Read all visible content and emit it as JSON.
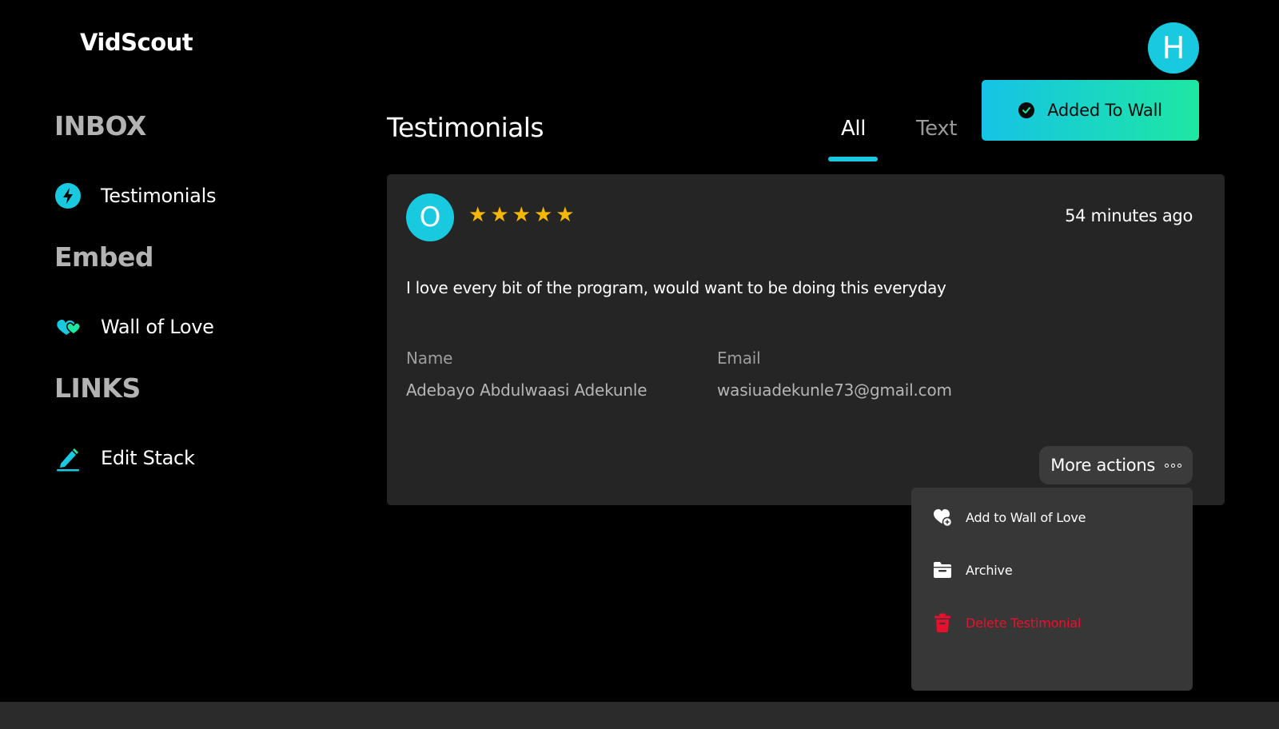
{
  "app": {
    "logo": "VidScout",
    "user_initial": "H"
  },
  "sidebar": {
    "sections": [
      {
        "heading": "INBOX",
        "items": [
          {
            "label": "Testimonials",
            "icon": "bolt-icon"
          }
        ]
      },
      {
        "heading": "Embed",
        "items": [
          {
            "label": "Wall of Love",
            "icon": "hearts-icon"
          }
        ]
      },
      {
        "heading": "LINKS",
        "items": [
          {
            "label": "Edit Stack",
            "icon": "pencil-icon"
          }
        ]
      }
    ]
  },
  "main": {
    "title": "Testimonials",
    "tabs": [
      {
        "label": "All",
        "active": true
      },
      {
        "label": "Text",
        "active": false
      }
    ]
  },
  "toast": {
    "text": "Added To Wall",
    "icon": "check-circle-icon"
  },
  "testimonial": {
    "initial": "O",
    "rating": 5,
    "stars": "★★★★★",
    "time": "54 minutes ago",
    "message": "I love every bit of the program, would want to be doing this everyday",
    "name_label": "Name",
    "name": "Adebayo Abdulwaasi Adekunle",
    "email_label": "Email",
    "email": "wasiuadekunle73@gmail.com",
    "more_actions_label": "More actions"
  },
  "menu": {
    "items": [
      {
        "label": "Add to Wall of Love",
        "icon": "heart-plus-icon"
      },
      {
        "label": "Archive",
        "icon": "archive-icon"
      },
      {
        "label": "Delete Testimonial",
        "icon": "trash-icon",
        "danger": true
      }
    ]
  },
  "colors": {
    "accent": "#18c9df",
    "accent_green": "#1ee7a3",
    "star": "#f5b800",
    "danger": "#e8112d",
    "card_bg": "#252525"
  }
}
